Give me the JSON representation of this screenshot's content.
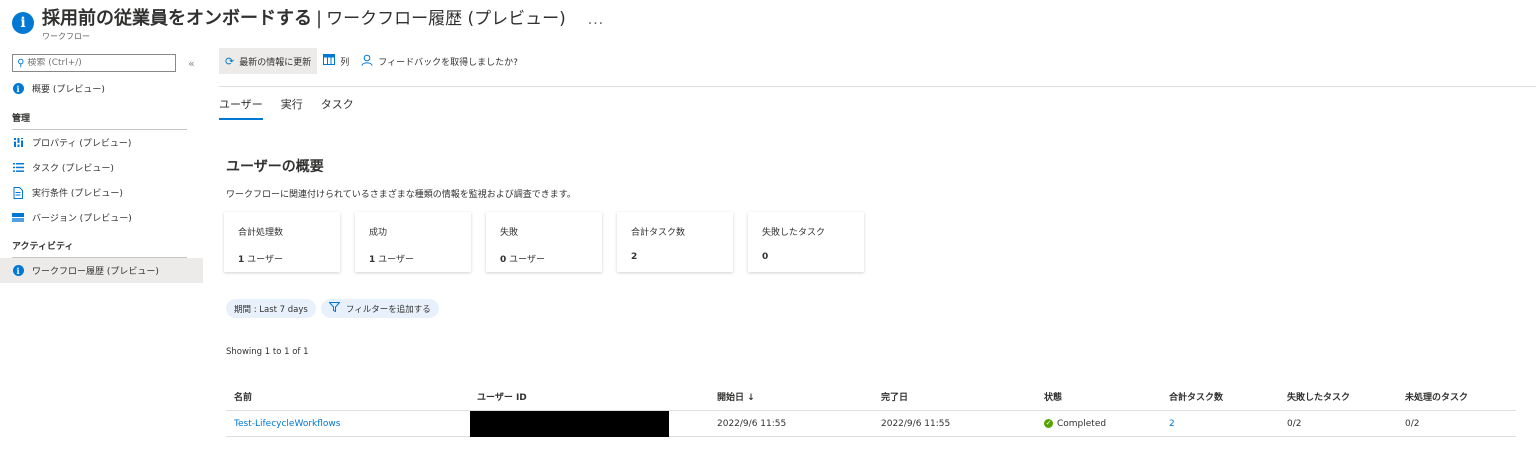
{
  "header": {
    "title": "採用前の従業員をオンボードする",
    "separator": "|",
    "section": "ワークフロー履歴 (プレビュー)",
    "more": "...",
    "subtitle": "ワークフロー"
  },
  "sidebar": {
    "search_placeholder": "検索 (Ctrl+/)",
    "collapse": "«",
    "overview": "概要 (プレビュー)",
    "section_manage": "管理",
    "manage_items": [
      {
        "label": "プロパティ (プレビュー)",
        "icon": "properties-icon"
      },
      {
        "label": "タスク (プレビュー)",
        "icon": "tasks-icon"
      },
      {
        "label": "実行条件 (プレビュー)",
        "icon": "document-icon"
      },
      {
        "label": "バージョン (プレビュー)",
        "icon": "versions-icon"
      }
    ],
    "section_activity": "アクティビティ",
    "activity_items": [
      {
        "label": "ワークフロー履歴 (プレビュー)",
        "icon": "info-icon",
        "selected": true
      }
    ]
  },
  "toolbar": {
    "refresh": "最新の情報に更新",
    "columns": "列",
    "feedback": "フィードバックを取得しましたか?"
  },
  "tabs": [
    "ユーザー",
    "実行",
    "タスク"
  ],
  "overview": {
    "title": "ユーザーの概要",
    "description": "ワークフローに関連付けられているさまざまな種類の情報を監視および調査できます。",
    "cards": [
      {
        "label": "合計処理数",
        "value": "1",
        "unit": "ユーザー"
      },
      {
        "label": "成功",
        "value": "1",
        "unit": "ユーザー"
      },
      {
        "label": "失敗",
        "value": "0",
        "unit": "ユーザー"
      },
      {
        "label": "合計タスク数",
        "value": "2",
        "unit": ""
      },
      {
        "label": "失敗したタスク",
        "value": "0",
        "unit": ""
      }
    ]
  },
  "filters": {
    "period": "期間 : Last 7 days",
    "add_filter": "フィルターを追加する"
  },
  "showing": "Showing 1 to 1 of 1",
  "table": {
    "headers": [
      "名前",
      "ユーザー ID",
      "開始日 ↓",
      "完了日",
      "状態",
      "合計タスク数",
      "失敗したタスク",
      "未処理のタスク"
    ],
    "rows": [
      {
        "name": "Test-LifecycleWorkflows",
        "user_id": "",
        "start": "2022/9/6 11:55",
        "end": "2022/9/6 11:55",
        "status": "Completed",
        "total_tasks": "2",
        "failed_tasks": "0/2",
        "pending_tasks": "0/2"
      }
    ]
  },
  "colors": {
    "accent": "#0078d4",
    "success": "#57a300",
    "selected_bg": "#edebe9"
  }
}
